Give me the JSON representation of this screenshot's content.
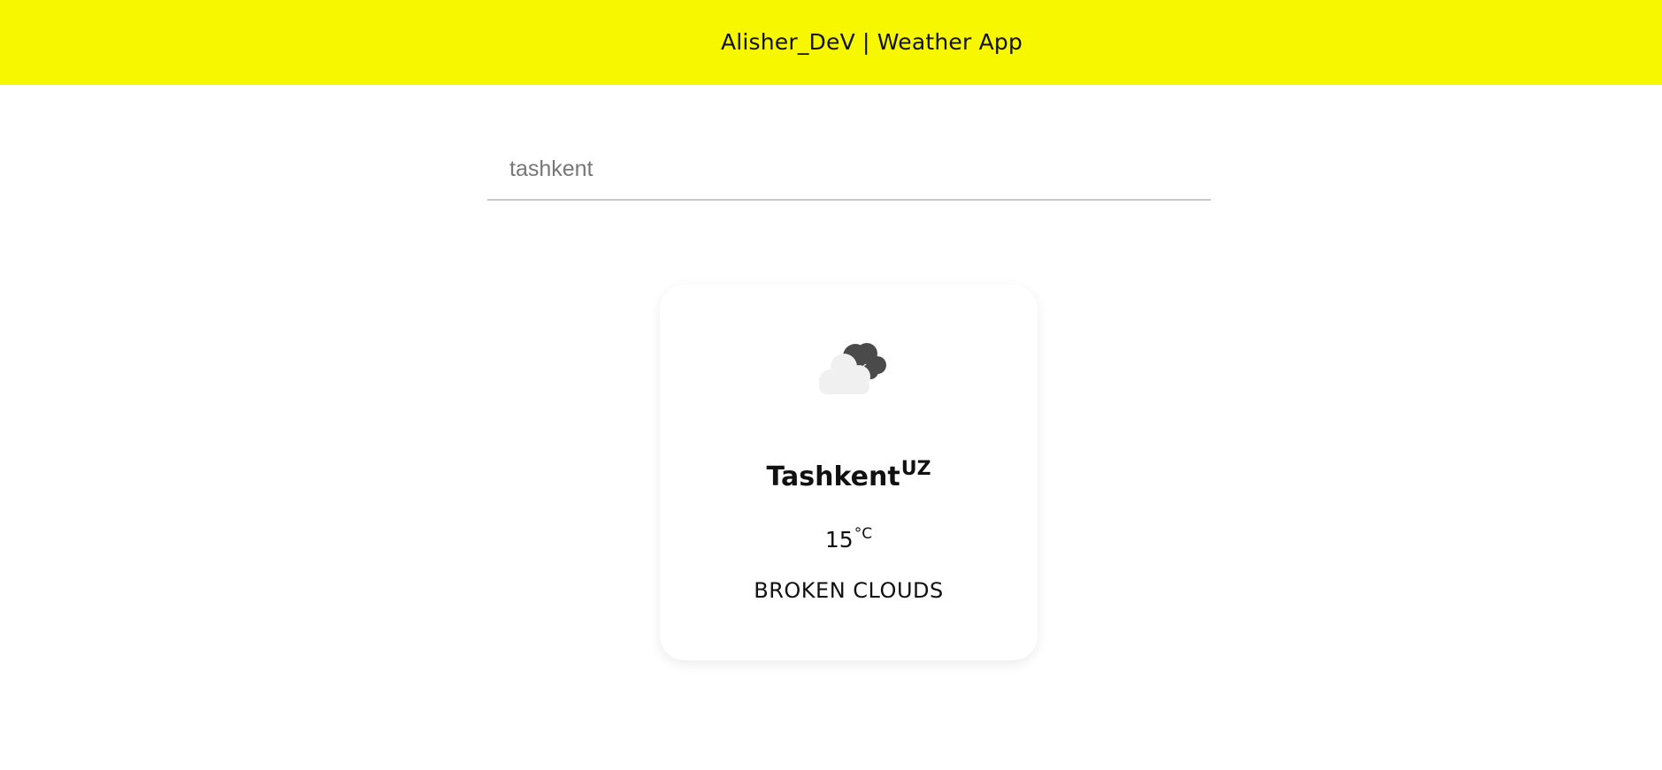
{
  "header": {
    "title": "Alisher_DeV | Weather App"
  },
  "search": {
    "value": "tashkent",
    "placeholder": "",
    "icon": "none"
  },
  "weather": {
    "city": "Tashkent",
    "country": "UZ",
    "temperature": "15",
    "unit": "°C",
    "description": "BROKEN CLOUDS",
    "icon": "broken-clouds-icon"
  },
  "colors": {
    "header_background": "#f7f700",
    "page_background": "#ffffff",
    "text": "#111111",
    "search_text": "#777777",
    "underline": "#c9c9c9",
    "cloud_light": "#f0f0f0",
    "cloud_dark": "#4a4a4a"
  }
}
